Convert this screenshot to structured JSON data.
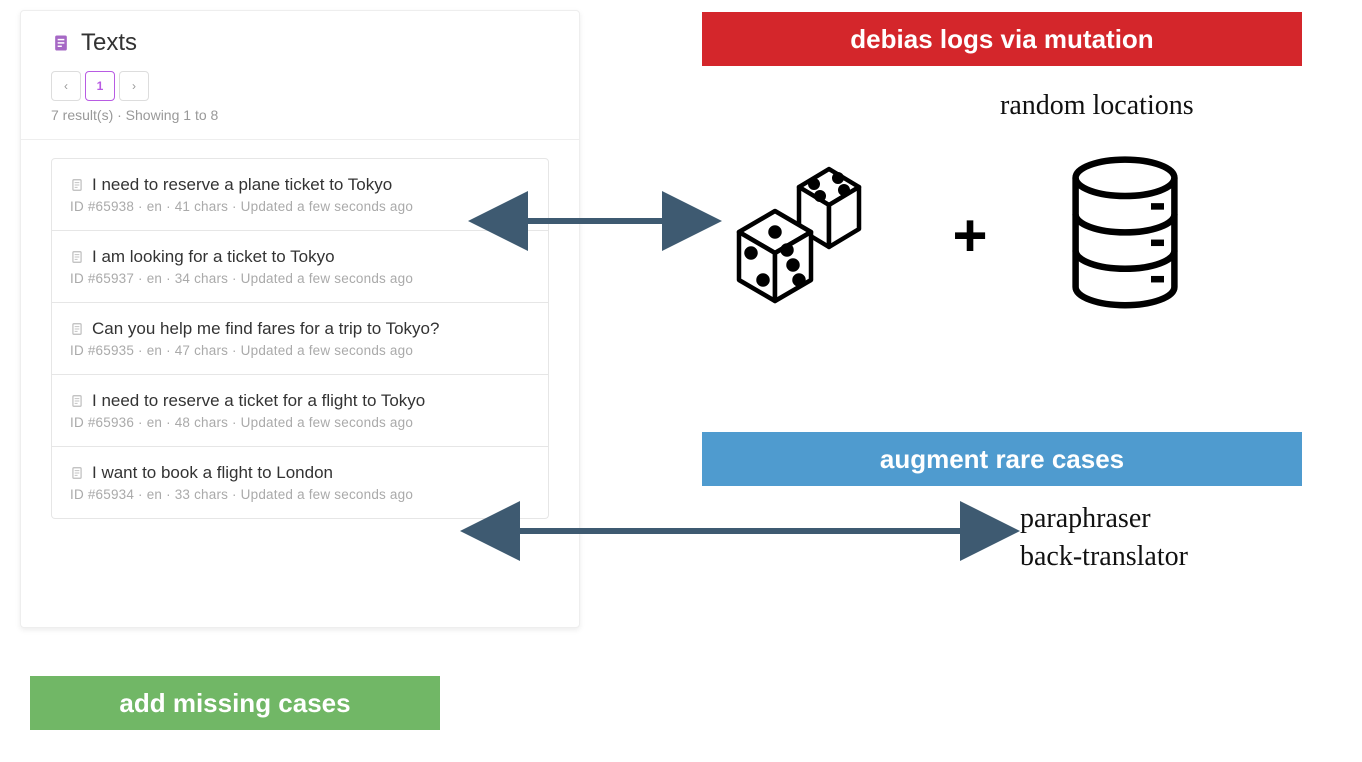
{
  "texts_panel": {
    "title": "Texts",
    "pager": {
      "prev": "‹",
      "current": "1",
      "next": "›"
    },
    "summary": "7 result(s) · Showing 1 to 8",
    "items": [
      {
        "text": "I need to reserve a plane ticket to Tokyo",
        "meta": "ID #65938 · en · 41 chars · Updated a few seconds ago"
      },
      {
        "text": "I am looking for a ticket to Tokyo",
        "meta": "ID #65937 · en · 34 chars · Updated a few seconds ago"
      },
      {
        "text": "Can you help me find fares for a trip to Tokyo?",
        "meta": "ID #65935 · en · 47 chars · Updated a few seconds ago"
      },
      {
        "text": "I need to reserve a ticket for a flight to Tokyo",
        "meta": "ID #65936 · en · 48 chars · Updated a few seconds ago"
      },
      {
        "text": "I want to book a flight to London",
        "meta": "ID #65934 · en · 33 chars · Updated a few seconds ago"
      }
    ]
  },
  "banners": {
    "red": "debias logs via mutation",
    "blue": "augment rare cases",
    "green": "add missing cases"
  },
  "right": {
    "random_locations": "random locations",
    "plus": "+",
    "augment_line1": "paraphraser",
    "augment_line2": "back-translator"
  }
}
